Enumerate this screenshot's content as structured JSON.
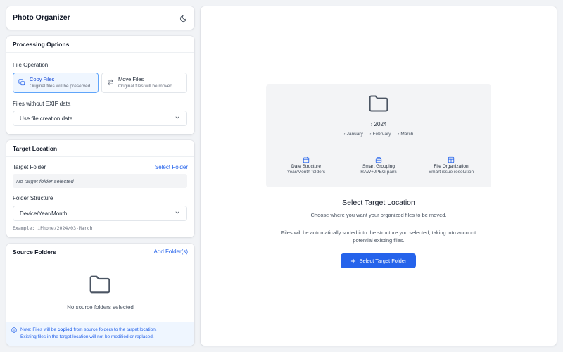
{
  "app": {
    "title": "Photo Organizer",
    "theme_icon": "moon-icon"
  },
  "processing": {
    "title": "Processing Options",
    "file_operation_label": "File Operation",
    "options": [
      {
        "title": "Copy Files",
        "subtitle": "Original files will be preserved",
        "icon": "copy-icon",
        "selected": true
      },
      {
        "title": "Move Files",
        "subtitle": "Original files will be moved",
        "icon": "swap-arrows-icon",
        "selected": false
      }
    ],
    "exif_label": "Files without EXIF data",
    "exif_value": "Use file creation date"
  },
  "target": {
    "title": "Target Location",
    "folder_label": "Target Folder",
    "select_folder": "Select Folder",
    "folder_value": "No target folder selected",
    "structure_label": "Folder Structure",
    "structure_value": "Device/Year/Month",
    "example": "Example: iPhone/2024/03-March"
  },
  "source": {
    "title": "Source Folders",
    "add_button": "Add Folder(s)",
    "empty_text": "No source folders selected",
    "note_prefix": "Note: Files will be ",
    "note_bold": "copied",
    "note_suffix": " from source folders to the target location.",
    "note_line2": "Existing files in the target location will not be modified or replaced."
  },
  "main": {
    "tree": {
      "year": "2024",
      "months": [
        "January",
        "February",
        "March"
      ]
    },
    "features": [
      {
        "icon": "calendar-icon",
        "title": "Date Structure",
        "subtitle": "Year/Month folders"
      },
      {
        "icon": "stack-icon",
        "title": "Smart Grouping",
        "subtitle": "RAW+JPEG pairs"
      },
      {
        "icon": "grid-icon",
        "title": "File Organization",
        "subtitle": "Smart issue resolution"
      }
    ],
    "heading": "Select Target Location",
    "subheading": "Choose where you want your organized files to be moved.",
    "description_line1": "Files will be automatically sorted into the structure you selected, taking into account",
    "description_line2": "potential existing files.",
    "cta": "Select Target Folder"
  },
  "colors": {
    "accent": "#2563eb",
    "background": "#f1f3f6",
    "note_bg": "#eff6ff"
  }
}
